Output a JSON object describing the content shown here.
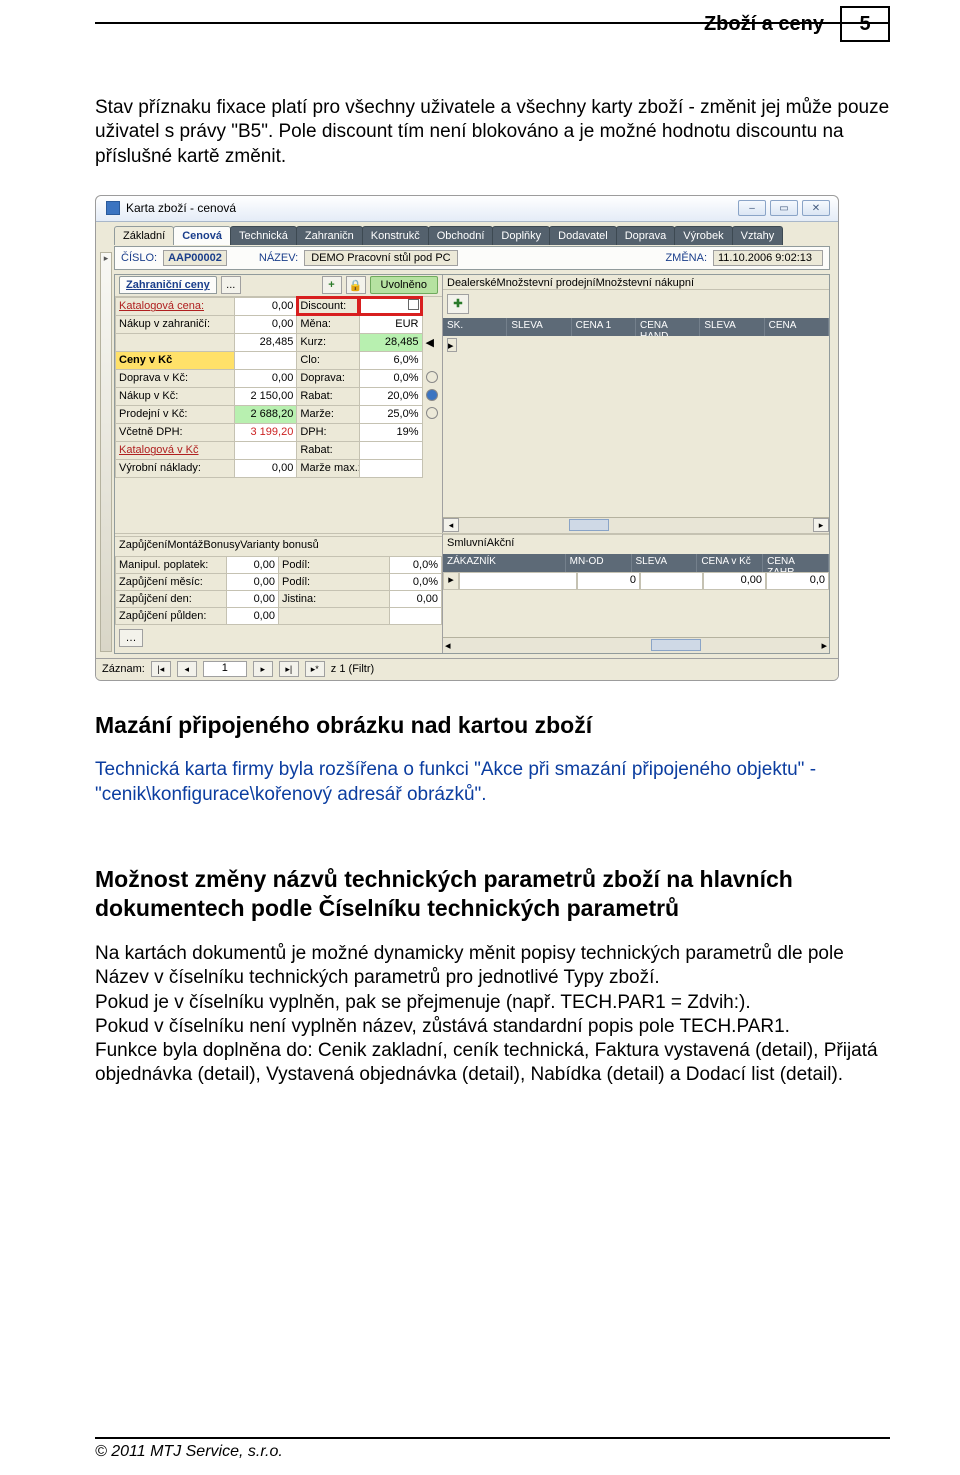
{
  "header": {
    "title": "Zboží a ceny",
    "pageNumber": "5"
  },
  "paragraphs": {
    "intro1": "Stav příznaku fixace platí pro všechny uživatele a všechny karty zboží - změnit jej může pouze uživatel s právy \"B5\". Pole discount tím není blokováno a je možné hodnotu discountu na příslušné kartě změnit.",
    "h2_1": "Mazání připojeného obrázku nad kartou zboží",
    "p2": "Technická karta firmy byla rozšířena o  funkci \"Akce při smazání připojeného objektu\" - \"cenik\\konfigurace\\kořenový adresář obrázků\".",
    "h2_2": "Možnost změny názvů technických parametrů zboží na hlavních dokumentech podle Číselníku technických parametrů",
    "p3a": "Na kartách dokumentů je možné dynamicky měnit popisy technických parametrů dle pole Název v číselníku technických parametrů pro jednotlivé Typy zboží.",
    "p3b": "Pokud je v číselníku vyplněn, pak se přejmenuje (např. TECH.PAR1 = Zdvih:).",
    "p3c": "Pokud v číselníku není vyplněn název, zůstává standardní popis pole TECH.PAR1.",
    "p3d": "Funkce byla doplněna do: Cenik zakladní, ceník technická, Faktura vystavená (detail), Přijatá objednávka (detail), Vystavená objednávka (detail), Nabídka  (detail) a Dodací list (detail)."
  },
  "embed": {
    "windowTitle": "Karta zboží - cenová",
    "mainTabs": [
      "Základní",
      "Cenová",
      "Technická",
      "Zahraničn",
      "Konstrukč",
      "Obchodní",
      "Doplňky",
      "Dodavatel",
      "Doprava",
      "Výrobek",
      "Vztahy"
    ],
    "activeMainTab": 1,
    "idRow": {
      "cisloLabel": "ČÍSLO:",
      "cislo": "AAP00002",
      "nazevLabel": "NÁZEV:",
      "nazev": "DEMO Pracovní stůl pod PC",
      "zmenaLabel": "ZMĚNA:",
      "zmena": "11.10.2006 9:02:13"
    },
    "leftStrip": {
      "tab": "Zahraniční ceny",
      "dots": "...",
      "plus": "+",
      "lock": "🔒",
      "uvolneno": "Uvolněno"
    },
    "leftGrid": [
      {
        "l": "Katalogová cena:",
        "v": "0,00",
        "l2": "Discount:",
        "v2": "",
        "cls": "redlink",
        "redbox": true,
        "checkbox": true
      },
      {
        "l": "Nákup v zahraničí:",
        "v": "0,00",
        "l2": "Měna:",
        "v2": "EUR"
      },
      {
        "l": "",
        "v": "28,485",
        "l2": "Kurz:",
        "v2": "28,485",
        "v2green": true,
        "arrow": true
      },
      {
        "l": "Ceny v Kč",
        "v": "",
        "l2": "Clo:",
        "v2": "6,0%",
        "cls": "yellow"
      },
      {
        "l": "Doprava v Kč:",
        "v": "0,00",
        "l2": "Doprava:",
        "v2": "0,0%",
        "dot": true
      },
      {
        "l": "Nákup v Kč:",
        "v": "2 150,00",
        "l2": "Rabat:",
        "v2": "20,0%",
        "dotFill": true
      },
      {
        "l": "Prodejní v Kč:",
        "v": "2 688,20",
        "l2": "Marže:",
        "v2": "25,0%",
        "vgreen": true,
        "dot": true
      },
      {
        "l": "Včetně DPH:",
        "v": "3 199,20",
        "l2": "DPH:",
        "v2": "19%",
        "cls": "redvals"
      },
      {
        "l": "Katalogová v Kč",
        "v": "",
        "l2": "Rabat:",
        "v2": "",
        "cls": "redlink"
      },
      {
        "l": "Výrobní náklady:",
        "v": "0,00",
        "l2": "Marže max.:",
        "v2": ""
      }
    ],
    "rightTabs": [
      "Dealerské",
      "Množstevní prodejní",
      "Množstevní nákupní"
    ],
    "rightActiveTab": 0,
    "rightCols1": [
      "SK.",
      "SLEVA",
      "CENA 1",
      "CENA HAND.",
      "SLEVA",
      "CENA"
    ],
    "lowerLeftTabs": [
      "Zapůjčení",
      "Montáž",
      "Bonusy",
      "Varianty bonusů"
    ],
    "lowerRightTabs": [
      "Smluvní",
      "Akční"
    ],
    "lowerLeftGrid": [
      {
        "l": "Manipul. poplatek:",
        "v": "0,00",
        "l2": "Podíl:",
        "v2": "0,0%"
      },
      {
        "l": "Zapůjčení měsíc:",
        "v": "0,00",
        "l2": "Podíl:",
        "v2": "0,0%"
      },
      {
        "l": "Zapůjčení den:",
        "v": "0,00",
        "l2": "Jistina:",
        "v2": "0,00"
      },
      {
        "l": "Zapůjčení půlden:",
        "v": "0,00",
        "l2": "",
        "v2": ""
      }
    ],
    "lowerRightCols": [
      "ZÁKAZNÍK",
      "MN-OD",
      "SLEVA",
      "CENA v Kč",
      "CENA ZAHR"
    ],
    "lowerRightRow": [
      "",
      "0",
      "",
      "0,00",
      "0,0"
    ],
    "status": {
      "label": "Záznam:",
      "current": "1",
      "total": "z  1 (Filtr)"
    }
  },
  "footer": "© 2011 MTJ Service, s.r.o."
}
